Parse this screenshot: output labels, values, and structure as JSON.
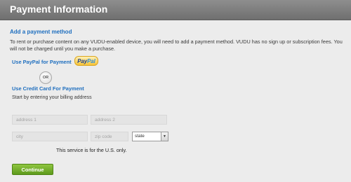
{
  "header": {
    "title": "Payment Information"
  },
  "intro": {
    "title": "Add a payment method",
    "text": "To rent or purchase content on any VUDU-enabled device, you will need to add a payment method. VUDU has no sign up or subscription fees. You will not be charged until you make a purchase."
  },
  "paypal": {
    "label": "Use PayPal for Payment",
    "button_part1": "Pay",
    "button_part2": "Pal"
  },
  "or_label": "OR",
  "credit_card": {
    "label": "Use Credit Card For Payment",
    "subtitle": "Start by entering your billing address"
  },
  "fields": {
    "address1": {
      "placeholder": "address 1",
      "value": ""
    },
    "address2": {
      "placeholder": "address 2",
      "value": ""
    },
    "city": {
      "placeholder": "city",
      "value": ""
    },
    "zip": {
      "placeholder": "zip code",
      "value": ""
    },
    "state": {
      "selected": "state"
    }
  },
  "note": "This service is for the U.S. only.",
  "continue_label": "Continue",
  "colors": {
    "header": "#7a7a7a",
    "accent_blue": "#1f6fbf",
    "continue_green": "#6fae2a",
    "background": "#ececec"
  }
}
